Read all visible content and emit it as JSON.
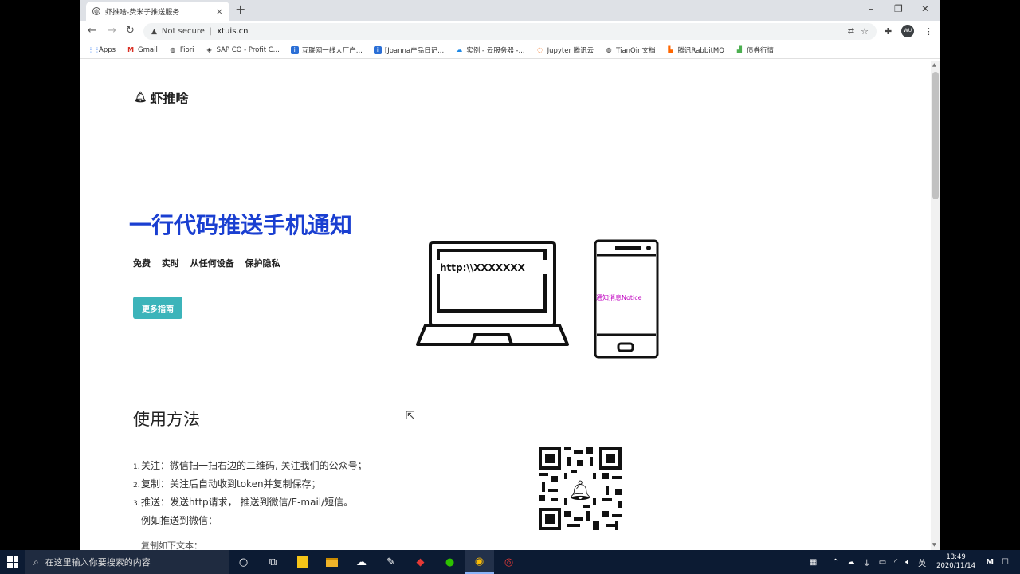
{
  "browser": {
    "tab_title": "虾推啥-费米子推送服务",
    "tab_close": "×",
    "new_tab": "+",
    "security_label": "Not secure",
    "url": "xtuis.cn",
    "profile_initials": "WU",
    "window_controls": [
      "–",
      "❐",
      "✕"
    ]
  },
  "bookmarks": [
    {
      "label": "Apps",
      "icon": "apps-grid-icon"
    },
    {
      "label": "Gmail",
      "icon": "gmail-icon"
    },
    {
      "label": "Fiori",
      "icon": "globe-icon"
    },
    {
      "label": "SAP CO - Profit C...",
      "icon": "sap-icon"
    },
    {
      "label": "互联网一线大厂产...",
      "icon": "doc-icon"
    },
    {
      "label": "[Joanna产品日记...",
      "icon": "doc-icon"
    },
    {
      "label": "实例 - 云服务器 -...",
      "icon": "cloud-icon"
    },
    {
      "label": "Jupyter 腾讯云",
      "icon": "jupyter-icon"
    },
    {
      "label": "TianQin文档",
      "icon": "globe-icon"
    },
    {
      "label": "腾讯RabbitMQ",
      "icon": "rabbitmq-icon"
    },
    {
      "label": "债券行情",
      "icon": "chart-icon"
    }
  ],
  "page": {
    "logo_text": "虾推啥",
    "hero_title": "一行代码推送手机通知",
    "hero_features": [
      "免费",
      "实时",
      "从任何设备",
      "保护隐私"
    ],
    "more_button": "更多指南",
    "laptop_text": "http:\\\\XXXXXXX",
    "phone_text": "通知消息Notice",
    "section_title": "使用方法",
    "steps": [
      "关注：微信扫一扫右边的二维码, 关注我们的公众号；",
      "复制：关注后自动收到token并复制保存；",
      "推送：发送http请求，  推送到微信/E-mail/短信。"
    ],
    "example_label": "例如推送到微信：",
    "copy_label": "复制如下文本："
  },
  "taskbar": {
    "search_placeholder": "在这里输入你要搜索的内容",
    "ime": "英",
    "time": "13:49",
    "date": "2020/11/14"
  },
  "colors": {
    "hero_title": "#1a3fd1",
    "button": "#3cb4ba",
    "phone_text": "#c000c0",
    "taskbar": "#0c1b33"
  }
}
